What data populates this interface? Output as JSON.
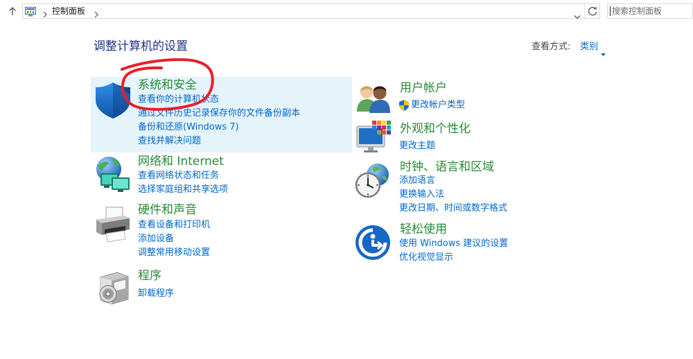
{
  "toolbar": {
    "up_icon": "up-arrow-icon",
    "location_icon": "control-panel-icon",
    "chevron_icon": "chevron-right-icon",
    "breadcrumb": [
      "控制面板"
    ],
    "dropdown_icon": "chevron-down-icon",
    "refresh_icon": "refresh-icon",
    "search_placeholder": "搜索控制面板"
  },
  "header": {
    "title": "调整计算机的设置",
    "view_by_label": "查看方式:",
    "view_by_value": "类别",
    "view_by_icon": "dropdown-triangle-icon"
  },
  "left": [
    {
      "title": "系统和安全",
      "icon": "shield-icon",
      "highlighted": true,
      "links": [
        "查看你的计算机状态",
        "通过文件历史记录保存你的文件备份副本",
        "备份和还原(Windows 7)",
        "查找并解决问题"
      ]
    },
    {
      "title": "网络和 Internet",
      "icon": "network-globe-icon",
      "links": [
        "查看网络状态和任务",
        "选择家庭组和共享选项"
      ]
    },
    {
      "title": "硬件和声音",
      "icon": "printer-icon",
      "links": [
        "查看设备和打印机",
        "添加设备",
        "调整常用移动设置"
      ]
    },
    {
      "title": "程序",
      "icon": "programs-icon",
      "links": [
        "卸载程序"
      ]
    }
  ],
  "right": [
    {
      "title": "用户帐户",
      "icon": "users-icon",
      "links": [
        "更改帐户类型"
      ],
      "link_icon": "uac-shield-icon"
    },
    {
      "title": "外观和个性化",
      "icon": "appearance-icon",
      "links": [
        "更改主题"
      ]
    },
    {
      "title": "时钟、语言和区域",
      "icon": "clock-globe-icon",
      "links": [
        "添加语言",
        "更换输入法",
        "更改日期、时间或数字格式"
      ]
    },
    {
      "title": "轻松使用",
      "icon": "ease-of-access-icon",
      "links": [
        "使用 Windows 建议的设置",
        "优化视觉显示"
      ]
    }
  ],
  "annotation": {
    "icon": "red-circle-annotation",
    "color": "#e8202a"
  },
  "colors": {
    "title": "#1e3287",
    "heading": "#278a37",
    "link": "#0066cc",
    "label": "#444444",
    "highlight": "#e5f3fb",
    "border": "#d9d9d9"
  }
}
